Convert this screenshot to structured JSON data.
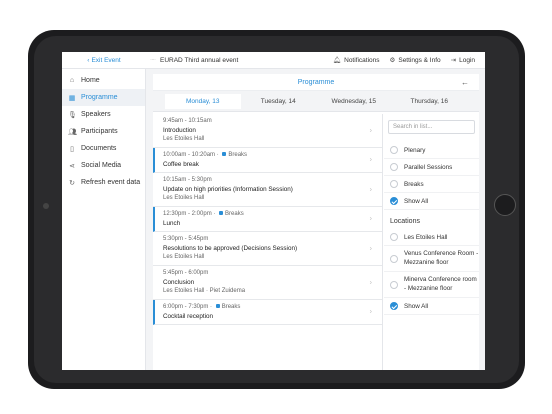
{
  "topbar": {
    "exit_label": "Exit Event",
    "event_title": "EURAD Third annual event",
    "notifications_label": "Notifications",
    "settings_label": "Settings & Info",
    "login_label": "Login"
  },
  "sidebar": {
    "items": [
      {
        "label": "Home",
        "icon": "home-icon"
      },
      {
        "label": "Programme",
        "icon": "calendar-icon"
      },
      {
        "label": "Speakers",
        "icon": "microphone-icon"
      },
      {
        "label": "Participants",
        "icon": "people-icon"
      },
      {
        "label": "Documents",
        "icon": "document-icon"
      },
      {
        "label": "Social Media",
        "icon": "share-icon"
      },
      {
        "label": "Refresh event data",
        "icon": "refresh-icon"
      }
    ]
  },
  "main": {
    "title": "Programme",
    "days": [
      "Monday, 13",
      "Tuesday, 14",
      "Wednesday, 15",
      "Thursday, 16"
    ],
    "sessions": [
      {
        "time": "9:45am - 10:15am",
        "title": "Introduction",
        "sub": "Les Etoiles Hall",
        "tag": ""
      },
      {
        "time": "10:00am - 10:20am",
        "title": "Coffee break",
        "sub": "",
        "tag": "Breaks"
      },
      {
        "time": "10:15am - 5:30pm",
        "title": "Update on high priorities (Information Session)",
        "sub": "Les Etoiles Hall",
        "tag": ""
      },
      {
        "time": "12:30pm - 2:00pm",
        "title": "Lunch",
        "sub": "",
        "tag": "Breaks"
      },
      {
        "time": "5:30pm - 5:45pm",
        "title": "Resolutions to be approved (Decisions Session)",
        "sub": "Les Etoiles Hall",
        "tag": ""
      },
      {
        "time": "5:45pm - 6:00pm",
        "title": "Conclusion",
        "sub": "Les Etoiles Hall · Piet Zuidema",
        "tag": ""
      },
      {
        "time": "6:00pm - 7:30pm",
        "title": "Cocktail reception",
        "sub": "",
        "tag": "Breaks"
      }
    ]
  },
  "filters": {
    "search_placeholder": "Search in list...",
    "types": [
      "Plenary",
      "Parallel Sessions",
      "Breaks",
      "Show All"
    ],
    "locations_label": "Locations",
    "locations": [
      "Les Etoiles Hall",
      "Venus Conference Room - Mezzanine floor",
      "Minerva Conference room - Mezzanine floor",
      "Show All"
    ]
  },
  "colors": {
    "accent": "#2a8ed6",
    "bezel": "#1c1c1e"
  }
}
